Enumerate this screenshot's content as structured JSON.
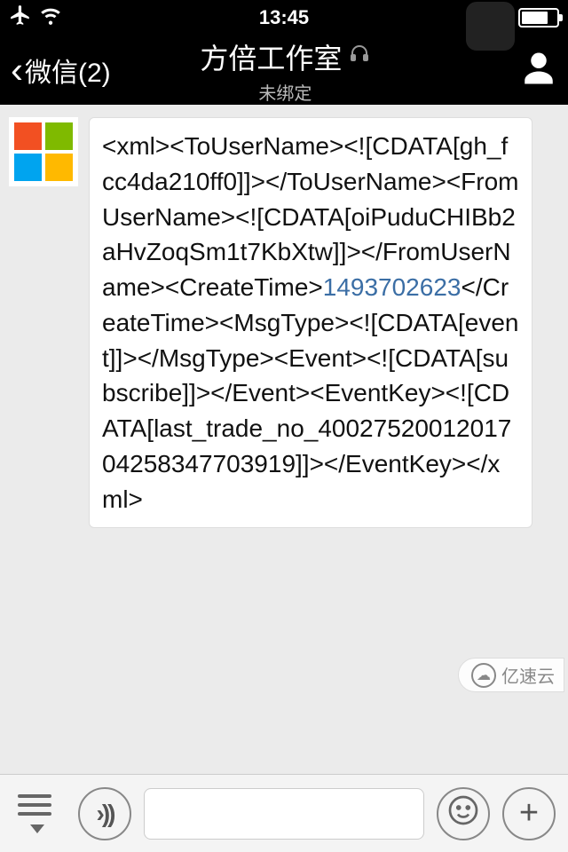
{
  "status": {
    "time": "13:45",
    "behind_text": "····"
  },
  "nav": {
    "back_label": "微信(2)",
    "title": "方倍工作室",
    "subtitle": "未绑定"
  },
  "message": {
    "xml": {
      "pre1": "<xml><ToUserName><![CDATA[gh_fcc4da210ff0]]></ToUserName><FromUserName><![CDATA[oiPuduCHIBb2aHvZoqSm1t7KbXtw]]></FromUserName><CreateTime>",
      "create_time": "1493702623",
      "post1": "</CreateTime><MsgType><![CDATA[event]]></MsgType><Event><![CDATA[subscribe]]></Event><EventKey><![CDATA[last_trade_no_4002752001201704258347703919]]></EventKey></xml>"
    }
  },
  "watermark": {
    "text": "亿速云"
  }
}
